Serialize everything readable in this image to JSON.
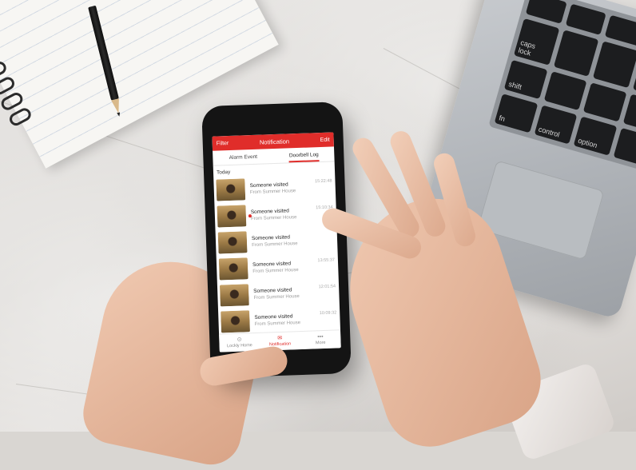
{
  "scene": {
    "objects": {
      "notebook": "spiral notebook",
      "pencil": "pencil",
      "laptop": "laptop",
      "phone": "smartphone",
      "hands": "hands"
    },
    "laptop_keys": [
      "caps lock",
      "shift",
      "fn",
      "control",
      "option"
    ]
  },
  "app": {
    "header": {
      "left": "Filter",
      "title": "Notification",
      "right": "Edit"
    },
    "tabs": [
      {
        "label": "Alarm Event",
        "active": false
      },
      {
        "label": "Doorbell Log",
        "active": true
      }
    ],
    "section": "Today",
    "items": [
      {
        "title": "Someone visited",
        "subtitle": "From Summer House",
        "time": "15:22:48",
        "unread": false
      },
      {
        "title": "Someone visited",
        "subtitle": "From Summer House",
        "time": "15:10:34",
        "unread": true
      },
      {
        "title": "Someone visited",
        "subtitle": "From Summer House",
        "time": "",
        "unread": false
      },
      {
        "title": "Someone visited",
        "subtitle": "From Summer House",
        "time": "13:55:37",
        "unread": false
      },
      {
        "title": "Someone visited",
        "subtitle": "From Summer House",
        "time": "12:01:54",
        "unread": false
      },
      {
        "title": "Someone visited",
        "subtitle": "From Summer House",
        "time": "10:09:32",
        "unread": false
      }
    ],
    "bottom_nav": [
      {
        "label": "Lockly Home",
        "icon": "home-icon",
        "active": false
      },
      {
        "label": "Notification",
        "icon": "bell-icon",
        "active": true
      },
      {
        "label": "More",
        "icon": "more-icon",
        "active": false
      }
    ],
    "accent_color": "#e02d2a"
  }
}
